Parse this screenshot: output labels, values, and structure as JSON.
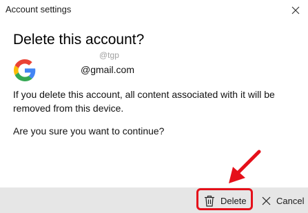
{
  "window": {
    "title": "Account settings",
    "close_icon": "close-icon"
  },
  "dialog": {
    "heading": "Delete this account?",
    "watermark": "@tgp",
    "account_icon": "google-g-icon",
    "email": "@gmail.com",
    "message": "If you delete this account, all content associated with it will be removed from this device.",
    "question": "Are you sure you want to continue?"
  },
  "footer": {
    "delete_label": "Delete",
    "delete_icon": "trash-icon",
    "cancel_label": "Cancel",
    "cancel_icon": "close-icon"
  },
  "annotation": {
    "color": "#e5101a"
  }
}
